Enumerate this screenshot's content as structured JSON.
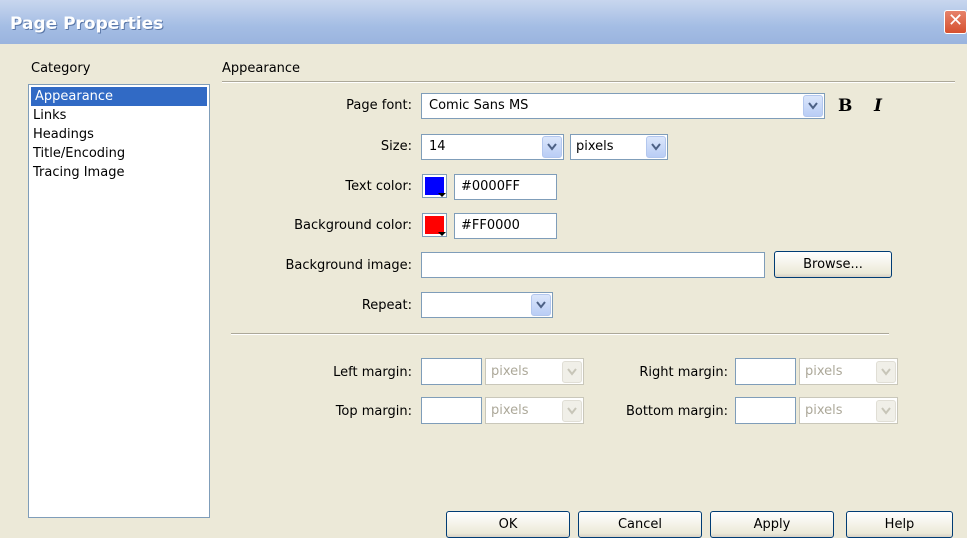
{
  "window": {
    "title": "Page Properties",
    "close_icon": "close-icon"
  },
  "category": {
    "label": "Category",
    "items": [
      "Appearance",
      "Links",
      "Headings",
      "Title/Encoding",
      "Tracing Image"
    ],
    "selected": "Appearance"
  },
  "section": {
    "title": "Appearance"
  },
  "form": {
    "page_font": {
      "label": "Page font:",
      "value": "Comic Sans MS"
    },
    "bold_label": "B",
    "italic_label": "I",
    "size": {
      "label": "Size:",
      "value": "14",
      "unit": "pixels"
    },
    "text_color": {
      "label": "Text color:",
      "value": "#0000FF",
      "swatch": "#0000FF"
    },
    "bg_color": {
      "label": "Background color:",
      "value": "#FF0000",
      "swatch": "#FF0000"
    },
    "bg_image": {
      "label": "Background image:",
      "value": "",
      "browse_label": "Browse..."
    },
    "repeat": {
      "label": "Repeat:",
      "value": ""
    }
  },
  "margins": {
    "left": {
      "label": "Left margin:",
      "value": "",
      "unit": "pixels"
    },
    "right": {
      "label": "Right margin:",
      "value": "",
      "unit": "pixels"
    },
    "top": {
      "label": "Top margin:",
      "value": "",
      "unit": "pixels"
    },
    "bottom": {
      "label": "Bottom margin:",
      "value": "",
      "unit": "pixels"
    }
  },
  "buttons": {
    "ok": "OK",
    "cancel": "Cancel",
    "apply": "Apply",
    "help": "Help"
  }
}
